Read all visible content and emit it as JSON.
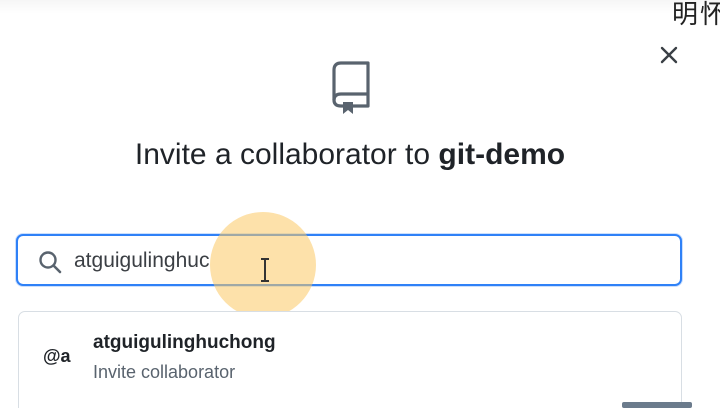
{
  "overlay_text": "明怀",
  "dialog": {
    "title_prefix": "Invite a collaborator to ",
    "repo_name": "git-demo",
    "close_icon": "close-icon",
    "repo_icon": "repo-icon"
  },
  "search": {
    "value": "atguigulinghuc",
    "icon": "search-icon"
  },
  "suggestion": {
    "avatar": "@a",
    "name": "atguigulinghuchong",
    "subtitle": "Invite collaborator"
  },
  "colors": {
    "focus_border": "#2f81f7",
    "click_highlight": "#fcc864",
    "text_primary": "#1f2328",
    "text_muted": "#59636e"
  }
}
